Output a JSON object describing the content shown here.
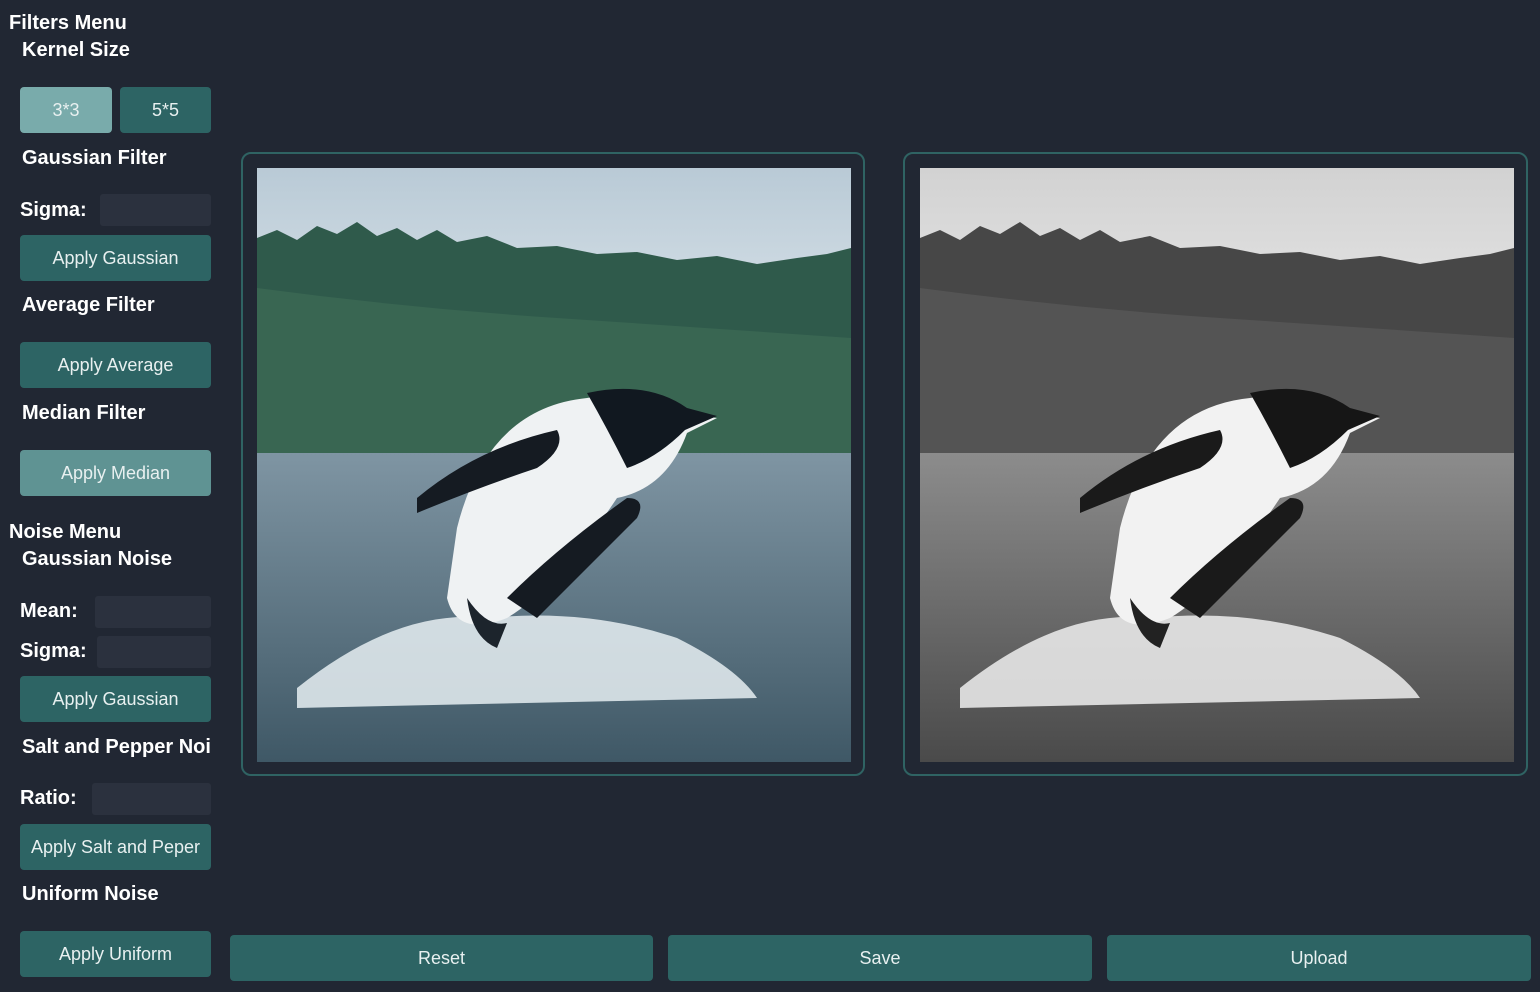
{
  "filters": {
    "menu_title": "Filters Menu",
    "kernel_size_label": "Kernel Size",
    "kernel_3_label": "3*3",
    "kernel_5_label": "5*5",
    "gaussian_title": "Gaussian Filter",
    "sigma_label": "Sigma:",
    "sigma_value": "",
    "apply_gaussian_label": "Apply Gaussian",
    "average_title": "Average Filter",
    "apply_average_label": "Apply Average",
    "median_title": "Median Filter",
    "apply_median_label": "Apply Median"
  },
  "noise": {
    "menu_title": "Noise Menu",
    "gaussian_title": "Gaussian Noise",
    "mean_label": "Mean:",
    "mean_value": "",
    "sigma_label": "Sigma:",
    "sigma_value": "",
    "apply_gaussian_label": "Apply Gaussian",
    "salt_pepper_title": "Salt and Pepper Noise",
    "ratio_label": "Ratio:",
    "ratio_value": "",
    "apply_salt_pepper_label": "Apply Salt and Peper",
    "uniform_title": "Uniform Noise",
    "apply_uniform_label": "Apply Uniform"
  },
  "bottom": {
    "reset_label": "Reset",
    "save_label": "Save",
    "upload_label": "Upload"
  },
  "colors": {
    "background": "#212733",
    "button": "#2d6464",
    "button_active": "#79abab",
    "frame_border": "#2f6363"
  }
}
